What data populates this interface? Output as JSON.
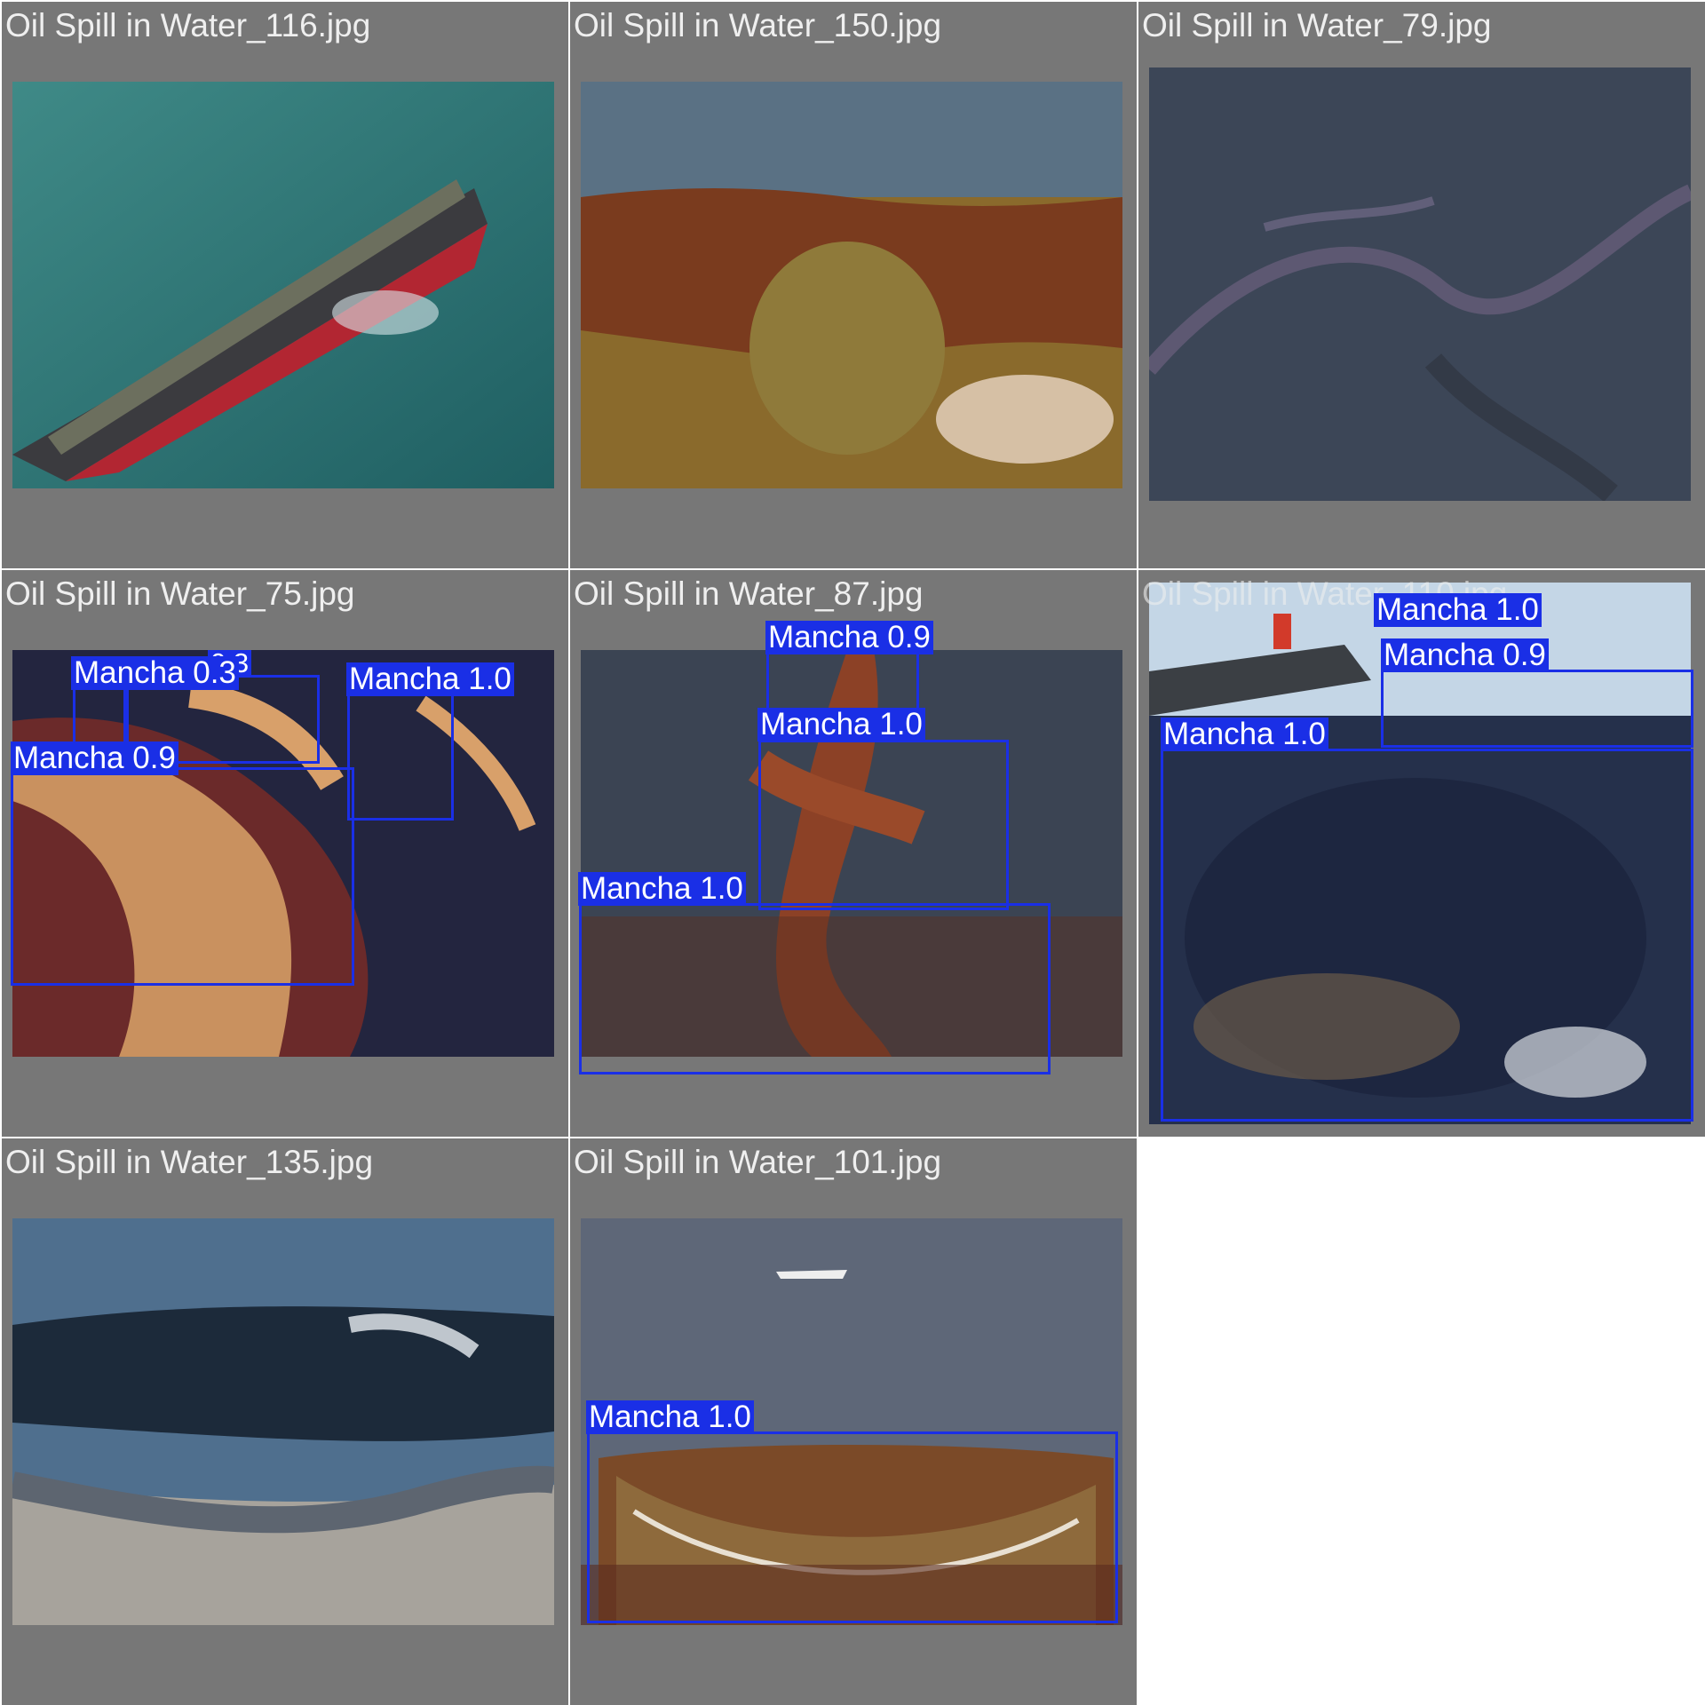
{
  "grid": {
    "cells": [
      {
        "title": "Oil Spill in Water_116.jpg",
        "detections": []
      },
      {
        "title": "Oil Spill in Water_150.jpg",
        "detections": []
      },
      {
        "title": "Oil Spill in Water_79.jpg",
        "detections": []
      },
      {
        "title": "Oil Spill in Water_75.jpg",
        "detections": [
          {
            "label": "Mancha 0.3"
          },
          {
            "label": "0.3"
          },
          {
            "label": "Mancha 1.0"
          },
          {
            "label": "Mancha 0.9"
          }
        ]
      },
      {
        "title": "Oil Spill in Water_87.jpg",
        "detections": [
          {
            "label": "Mancha 0.9"
          },
          {
            "label": "Mancha 1.0"
          },
          {
            "label": "Mancha 1.0"
          }
        ]
      },
      {
        "title": "Oil Spill in Water_110.jpg",
        "detections": [
          {
            "label": "Mancha 1.0"
          },
          {
            "label": "Mancha 0.9"
          },
          {
            "label": "Mancha 1.0"
          }
        ]
      },
      {
        "title": "Oil Spill in Water_135.jpg",
        "detections": []
      },
      {
        "title": "Oil Spill in Water_101.jpg",
        "detections": [
          {
            "label": "Mancha 1.0"
          }
        ]
      }
    ]
  },
  "colors": {
    "panel": "#777777",
    "box": "#1a2fe6",
    "background": "#ffffff"
  }
}
